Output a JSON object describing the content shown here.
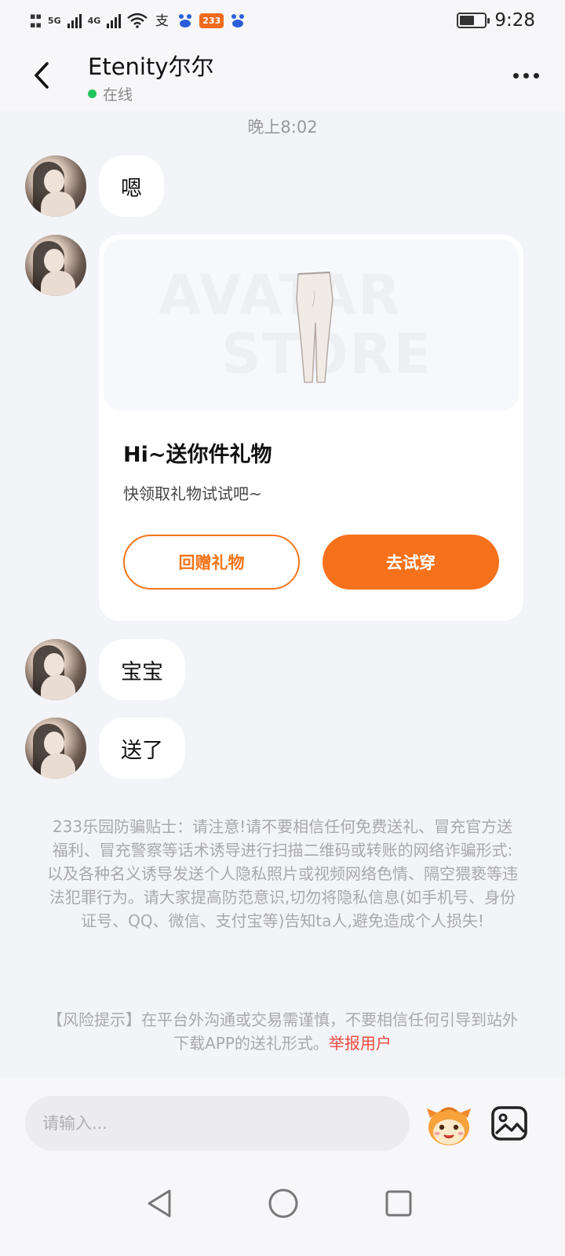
{
  "status_bar": {
    "time": "9:28",
    "network_1": "5G",
    "network_2": "4G",
    "app_badge": "233"
  },
  "header": {
    "contact_name": "Etenity尔尔",
    "status": "在线"
  },
  "chat": {
    "timestamp": "晚上8:02",
    "messages": [
      {
        "text": "嗯"
      },
      {
        "text": "宝宝"
      },
      {
        "text": "送了"
      }
    ],
    "gift_card": {
      "watermark_line1": "AVATAR",
      "watermark_line2": "STORE",
      "title": "Hi~送你件礼物",
      "subtitle": "快领取礼物试试吧~",
      "return_button": "回赠礼物",
      "try_on_button": "去试穿"
    }
  },
  "notice": {
    "anti_fraud": "233乐园防骗贴士：请注意!请不要相信任何免费送礼、冒充官方送福利、冒充警察等话术诱导进行扫描二维码或转账的网络诈骗形式:以及各种名义诱导发送个人隐私照片或视频网络色情、隔空猥亵等违法犯罪行为。请大家提高防范意识,切勿将隐私信息(如手机号、身份证号、QQ、微信、支付宝等)告知ta人,避免造成个人损失!",
    "risk_text": "【风险提示】在平台外沟通或交易需谨慎，不要相信任何引导到站外下载APP的送礼形式。",
    "report_link": "举报用户"
  },
  "input": {
    "placeholder": "请输入..."
  },
  "colors": {
    "accent": "#f6711b",
    "online": "#22c55e",
    "report": "#f04a3d"
  },
  "icons": [
    "back-arrow-icon",
    "more-icon",
    "emoji-icon",
    "image-icon",
    "nav-back-icon",
    "nav-home-icon",
    "nav-recent-icon"
  ]
}
